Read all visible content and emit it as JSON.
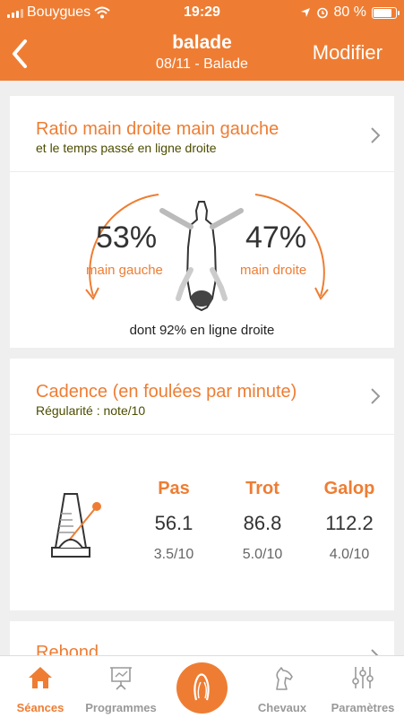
{
  "status": {
    "carrier": "Bouygues",
    "time": "19:29",
    "battery": "80 %",
    "battery_level": 0.8
  },
  "nav": {
    "title": "balade",
    "subtitle": "08/11 - Balade",
    "edit_label": "Modifier"
  },
  "ratio_card": {
    "title": "Ratio main droite main gauche",
    "subtitle": "et le temps passé en ligne droite",
    "left_pct": "53%",
    "left_label": "main gauche",
    "right_pct": "47%",
    "right_label": "main droite",
    "straight_note": "dont 92% en ligne droite"
  },
  "cadence_card": {
    "title": "Cadence (en foulées par minute)",
    "subtitle": "Régularité : note/10",
    "columns": [
      {
        "label": "Pas",
        "value": "56.1",
        "score": "3.5/10"
      },
      {
        "label": "Trot",
        "value": "86.8",
        "score": "5.0/10"
      },
      {
        "label": "Galop",
        "value": "112.2",
        "score": "4.0/10"
      }
    ]
  },
  "rebond_card": {
    "title": "Rebond"
  },
  "tabs": [
    {
      "label": "Séances",
      "icon": "home-icon"
    },
    {
      "label": "Programmes",
      "icon": "presentation-icon"
    },
    {
      "label": "",
      "icon": "horseshoe-record-icon"
    },
    {
      "label": "Chevaux",
      "icon": "horse-head-icon"
    },
    {
      "label": "Paramètres",
      "icon": "sliders-icon"
    }
  ],
  "colors": {
    "accent": "#ee7d33",
    "background": "#efefef"
  }
}
